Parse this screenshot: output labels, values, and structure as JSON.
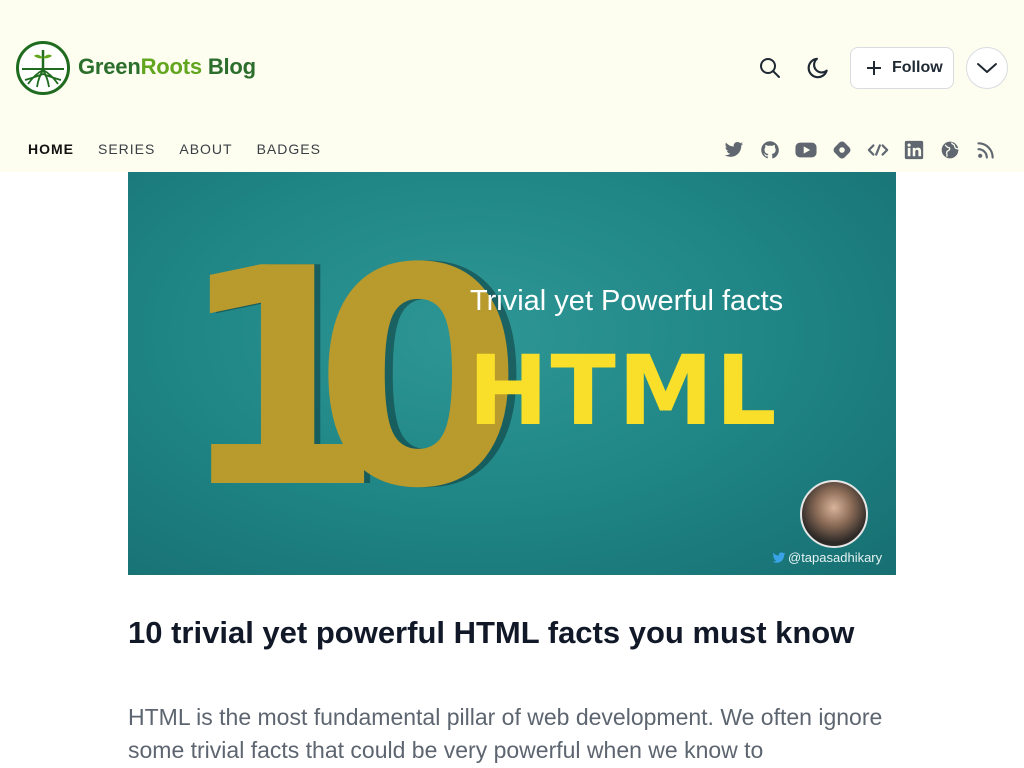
{
  "brand": {
    "part1": "Green",
    "part2": "Roots",
    "part3": " Blog"
  },
  "header": {
    "follow_label": "Follow"
  },
  "nav": [
    {
      "label": "HOME"
    },
    {
      "label": "SERIES"
    },
    {
      "label": "ABOUT"
    },
    {
      "label": "BADGES"
    }
  ],
  "social_icons": [
    "twitter-icon",
    "github-icon",
    "youtube-icon",
    "hashnode-icon",
    "dev-icon",
    "linkedin-icon",
    "globe-icon",
    "rss-icon"
  ],
  "cover": {
    "digit_one": "1",
    "digit_zero": "0",
    "subtitle": "Trivial yet Powerful facts",
    "bigword": "HTML",
    "handle": "@tapasadhikary"
  },
  "post": {
    "title": "10 trivial yet powerful HTML facts you must know",
    "excerpt": "HTML is the most fundamental pillar of web development. We often ignore some trivial facts that could be very powerful when we know to"
  },
  "colors": {
    "header_bg": "#fdfef0",
    "brand_dark_green": "#2c6e2c",
    "brand_light_green": "#62a51e",
    "cover_teal": "#1f8585",
    "cover_gold": "#b99a2c",
    "cover_yellow": "#f9df2a"
  }
}
